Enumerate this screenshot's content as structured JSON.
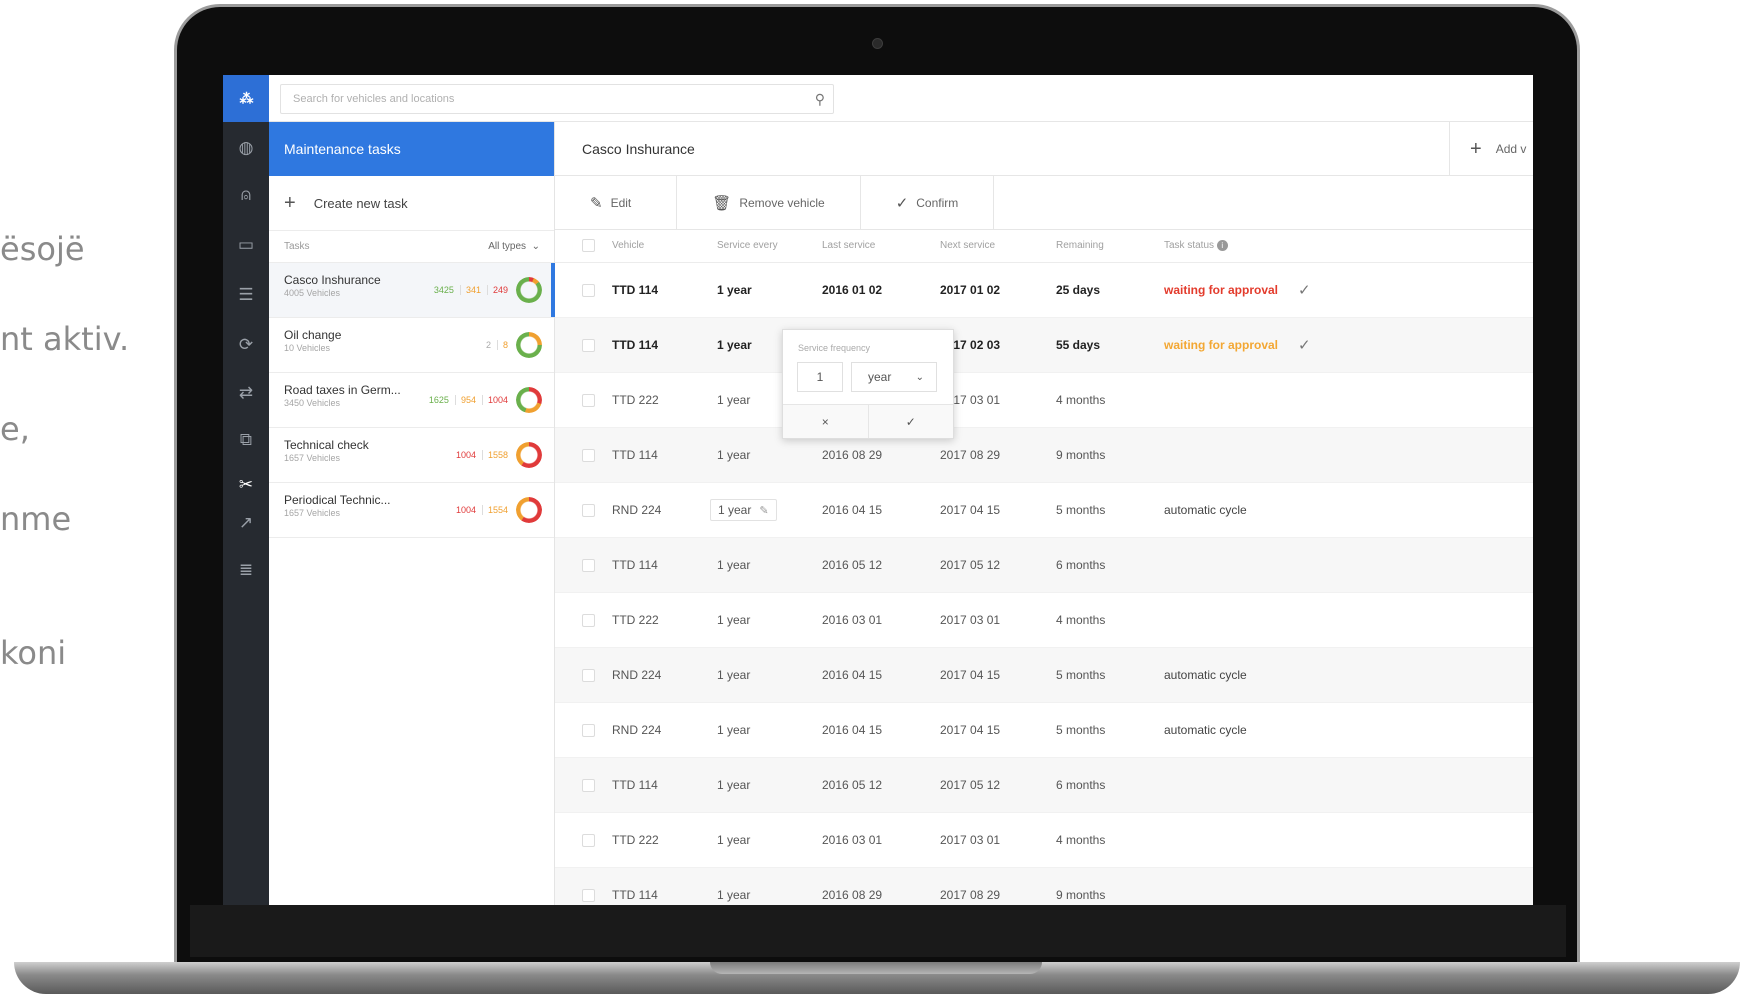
{
  "side_text": [
    "ësojë",
    "nt aktiv.",
    "e,",
    "nme",
    "koni"
  ],
  "search": {
    "placeholder": "Search for vehicles and locations"
  },
  "rail_icons": [
    "dashboard-icon",
    "user-icon",
    "chat-icon",
    "list-icon",
    "cycle-icon",
    "route-icon",
    "layers-icon",
    "tools-icon",
    "chart-icon",
    "stack-icon"
  ],
  "tasks_panel": {
    "title": "Maintenance tasks",
    "create_label": "Create new task",
    "tasks_label": "Tasks",
    "filter_label": "All types",
    "items": [
      {
        "name": "Casco Inshurance",
        "sub": "4005 Vehicles",
        "green": "3425",
        "orange": "341",
        "red": "249"
      },
      {
        "name": "Oil change",
        "sub": "10 Vehicles",
        "green": "",
        "orange": "2",
        "red": "8"
      },
      {
        "name": "Road taxes in Germ...",
        "sub": "3450 Vehicles",
        "green": "1625",
        "orange": "954",
        "red": "1004"
      },
      {
        "name": "Technical check",
        "sub": "1657 Vehicles",
        "green": "",
        "orange": "1004",
        "red": "1558"
      },
      {
        "name": "Periodical Technic...",
        "sub": "1657 Vehicles",
        "green": "",
        "orange": "1004",
        "red": "1554"
      }
    ]
  },
  "main": {
    "title": "Casco Inshurance",
    "add_label": "Add v",
    "toolbar": {
      "edit": "Edit",
      "remove": "Remove vehicle",
      "confirm": "Confirm"
    },
    "columns": [
      "Vehicle",
      "Service every",
      "Last service",
      "Next service",
      "Remaining",
      "Task status"
    ],
    "rows": [
      {
        "vehicle": "TTD 114",
        "every": "1 year",
        "last": "2016 01 02",
        "next": "2017 01 02",
        "remaining": "25 days",
        "status": "waiting for approval"
      },
      {
        "vehicle": "TTD 114",
        "every": "1 year",
        "last": "",
        "next": "2017 02 03",
        "remaining": "55 days",
        "status": "waiting for approval"
      },
      {
        "vehicle": "TTD 222",
        "every": "1 year",
        "last": "",
        "next": "2017 03 01",
        "remaining": "4 months",
        "status": ""
      },
      {
        "vehicle": "TTD 114",
        "every": "1 year",
        "last": "2016 08 29",
        "next": "2017 08 29",
        "remaining": "9 months",
        "status": ""
      },
      {
        "vehicle": "RND 224",
        "every": "1 year",
        "last": "2016 04 15",
        "next": "2017 04 15",
        "remaining": "5 months",
        "status": "automatic cycle"
      },
      {
        "vehicle": "TTD 114",
        "every": "1 year",
        "last": "2016 05 12",
        "next": "2017 05 12",
        "remaining": "6 months",
        "status": ""
      },
      {
        "vehicle": "TTD 222",
        "every": "1 year",
        "last": "2016 03 01",
        "next": "2017 03 01",
        "remaining": "4 months",
        "status": ""
      },
      {
        "vehicle": "RND 224",
        "every": "1 year",
        "last": "2016 04 15",
        "next": "2017 04 15",
        "remaining": "5 months",
        "status": "automatic cycle"
      },
      {
        "vehicle": "RND 224",
        "every": "1 year",
        "last": "2016 04 15",
        "next": "2017 04 15",
        "remaining": "5 months",
        "status": "automatic cycle"
      },
      {
        "vehicle": "TTD 114",
        "every": "1 year",
        "last": "2016 05 12",
        "next": "2017 05 12",
        "remaining": "6 months",
        "status": ""
      },
      {
        "vehicle": "TTD 222",
        "every": "1 year",
        "last": "2016 03 01",
        "next": "2017 03 01",
        "remaining": "4 months",
        "status": ""
      },
      {
        "vehicle": "TTD 114",
        "every": "1 year",
        "last": "2016 08 29",
        "next": "2017 08 29",
        "remaining": "9 months",
        "status": ""
      }
    ]
  },
  "popover": {
    "label": "Service frequency",
    "number": "1",
    "unit": "year",
    "cancel": "×",
    "ok": "✓"
  },
  "colors": {
    "brand": "#2f78e0",
    "rail": "#262a30",
    "danger": "#e33b2c",
    "warning": "#f3a733",
    "success": "#6ab04c"
  }
}
